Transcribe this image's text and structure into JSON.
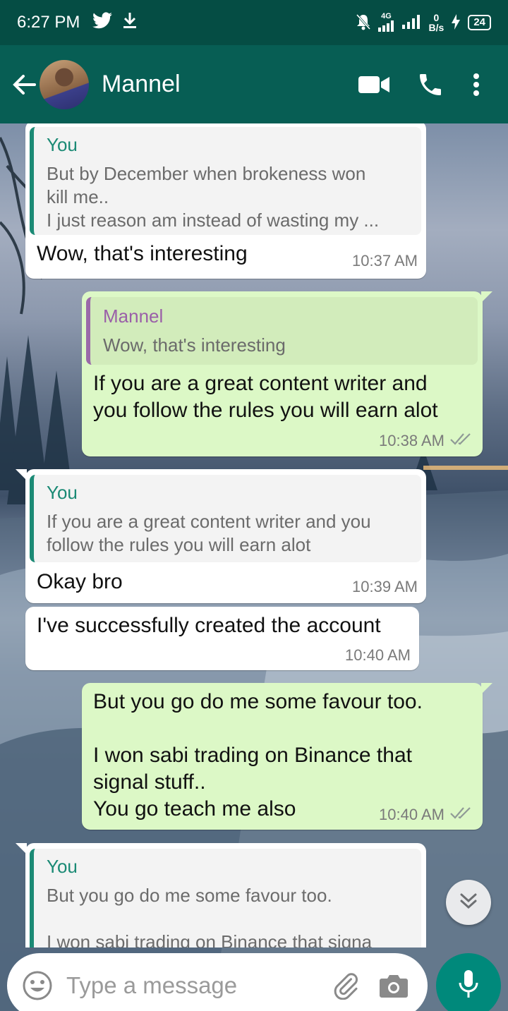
{
  "status_bar": {
    "time": "6:27 PM",
    "network": "4G",
    "data_rate_value": "0",
    "data_rate_unit": "B/s",
    "battery": "24"
  },
  "header": {
    "contact_name": "Mannel"
  },
  "messages": [
    {
      "direction": "in",
      "quote_author": "You",
      "quote_lines": [
        "But by December when brokeness won",
        "kill me..",
        "I just reason am instead of wasting my ..."
      ],
      "text": "Wow, that's interesting",
      "time": "10:37 AM"
    },
    {
      "direction": "out",
      "quote_author": "Mannel",
      "quote_lines": [
        "Wow, that's interesting"
      ],
      "text_lines": [
        "If you are a great content writer and",
        "you follow the rules you will earn alot"
      ],
      "time": "10:38 AM"
    },
    {
      "direction": "in",
      "quote_author": "You",
      "quote_lines": [
        "If you are a great content writer and you",
        "follow the rules you will earn alot"
      ],
      "text": "Okay bro",
      "time": "10:39 AM"
    },
    {
      "direction": "in",
      "text": "I've successfully created the account",
      "time": "10:40 AM"
    },
    {
      "direction": "out",
      "text_lines": [
        "But you go do me some favour too.",
        "",
        "I won sabi trading on Binance that",
        "signal stuff..",
        "You go teach me also"
      ],
      "time": "10:40 AM"
    },
    {
      "direction": "in",
      "quote_author": "You",
      "quote_lines": [
        "But you go do me some favour too.",
        "",
        "I won sabi trading on Binance that signa"
      ]
    }
  ],
  "input": {
    "placeholder": "Type a message"
  },
  "colors": {
    "header": "#075e54",
    "status_bar": "#054d44",
    "outgoing_bubble": "#dcf8c6",
    "incoming_bubble": "#ffffff",
    "mic_button": "#00897b"
  },
  "icons": [
    "twitter-icon",
    "download-icon",
    "mute-icon",
    "signal-icon",
    "charging-icon",
    "back-arrow-icon",
    "video-call-icon",
    "phone-icon",
    "more-vert-icon",
    "double-check-icon",
    "chevron-double-down-icon",
    "emoji-icon",
    "attach-icon",
    "camera-icon",
    "mic-icon"
  ]
}
